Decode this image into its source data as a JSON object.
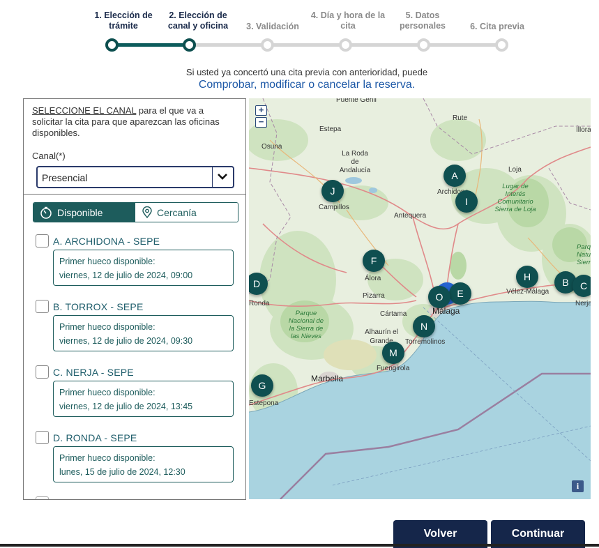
{
  "stepper": {
    "steps": [
      {
        "label": "1. Elección de trámite"
      },
      {
        "label": "2. Elección de canal y oficina"
      },
      {
        "label": "3. Validación"
      },
      {
        "label": "4. Día y hora de la cita"
      },
      {
        "label": "5. Datos personales"
      },
      {
        "label": "6. Cita previa"
      }
    ],
    "completed_steps": 2,
    "accent_color": "#0d5c5c"
  },
  "notice": {
    "text": "Si usted ya concertó una cita previa con anterioridad, puede",
    "link": "Comprobar, modificar o cancelar la reserva."
  },
  "panel": {
    "intro_underlined": "SELECCIONE EL CANAL",
    "intro_rest": " para el que va a solicitar la cita para que aparezcan las oficinas disponibles.",
    "canal_label": "Canal(*)",
    "canal_value": "Presencial",
    "toggle": {
      "disponible": "Disponible",
      "cercania": "Cercanía"
    },
    "offices": [
      {
        "name": "A. ARCHIDONA - SEPE",
        "slot_title": "Primer hueco disponible:",
        "slot_date": "viernes, 12 de julio de 2024, 09:00"
      },
      {
        "name": "B. TORROX - SEPE",
        "slot_title": "Primer hueco disponible:",
        "slot_date": "viernes, 12 de julio de 2024, 09:30"
      },
      {
        "name": "C. NERJA - SEPE",
        "slot_title": "Primer hueco disponible:",
        "slot_date": "viernes, 12 de julio de 2024, 13:45"
      },
      {
        "name": "D. RONDA - SEPE",
        "slot_title": "Primer hueco disponible:",
        "slot_date": "lunes, 15 de julio de 2024, 12:30"
      }
    ]
  },
  "map": {
    "zoom_in": "+",
    "zoom_out": "−",
    "info": "i",
    "places": {
      "puente_genil": "Puente Genil",
      "rute": "Rute",
      "illora": "Íllora",
      "estepa": "Estepa",
      "osuna": "Osuna",
      "roda": "La Roda de Andalucía",
      "loja": "Loja",
      "archidona": "Archidona",
      "campillos": "Campillos",
      "antequera": "Antequera",
      "lugar": "Lugar de Interés Comunitario Sierra de Loja",
      "parque_nat": "Parque Natural Sierra",
      "alora": "Álora",
      "velez": "Vélez-Málaga",
      "nerja": "Nerja",
      "ronda": "Ronda",
      "pizarra": "Pizarra",
      "cartama": "Cártama",
      "malaga": "Málaga",
      "parque_nieves": "Parque Nacional de la Sierra de las Nieves",
      "alhaurin": "Alhaurín el Grande",
      "torremolinos": "Torremolinos",
      "fuengirola": "Fuengirola",
      "marbella": "Marbella",
      "estepona": "Estepona"
    },
    "markers": [
      "A",
      "B",
      "C",
      "D",
      "E",
      "F",
      "G",
      "H",
      "I",
      "J",
      "M",
      "N",
      "O"
    ]
  },
  "buttons": {
    "back": "Volver",
    "continue": "Continuar"
  }
}
